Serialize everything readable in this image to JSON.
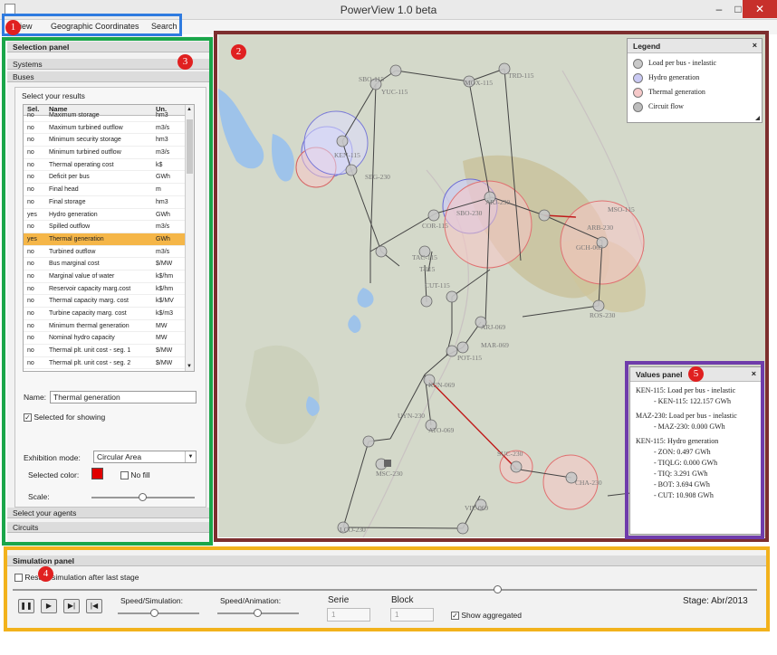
{
  "window": {
    "title": "PowerView 1.0 beta",
    "minimize": "–",
    "maximize": "□",
    "close": "✕"
  },
  "menu": {
    "view": "iew",
    "geo": "Geographic Coordinates",
    "search": "Search"
  },
  "callouts": [
    "1",
    "2",
    "3",
    "4",
    "5"
  ],
  "selection": {
    "title": "Selection panel",
    "systems": "Systems",
    "buses": "Buses",
    "select_results": "Select your results",
    "columns": [
      "Sel.",
      "Name",
      "Un."
    ],
    "rows": [
      [
        "no",
        "Maximum storage",
        "hm3"
      ],
      [
        "no",
        "Maximum turbined outflow",
        "m3/s"
      ],
      [
        "no",
        "Minimum security storage",
        "hm3"
      ],
      [
        "no",
        "Minimum turbined outflow",
        "m3/s"
      ],
      [
        "no",
        "Thermal operating cost",
        "k$"
      ],
      [
        "no",
        "Deficit per bus",
        "GWh"
      ],
      [
        "no",
        "Final head",
        "m"
      ],
      [
        "no",
        "Final storage",
        "hm3"
      ],
      [
        "yes",
        "Hydro generation",
        "GWh"
      ],
      [
        "no",
        "Spilled outflow",
        "m3/s"
      ],
      [
        "yes",
        "Thermal generation",
        "GWh"
      ],
      [
        "no",
        "Turbined outflow",
        "m3/s"
      ],
      [
        "no",
        "Bus marginal cost",
        "$/MW"
      ],
      [
        "no",
        "Marginal value of water",
        "k$/hm"
      ],
      [
        "no",
        "Reservoir capacity marg.cost",
        "k$/hm"
      ],
      [
        "no",
        "Thermal capacity marg. cost",
        "k$/MV"
      ],
      [
        "no",
        "Turbine capacity marg. cost",
        "k$/m3"
      ],
      [
        "no",
        "Minimum thermal generation",
        "MW"
      ],
      [
        "no",
        "Nominal hydro capacity",
        "MW"
      ],
      [
        "no",
        "Thermal plt. unit cost - seg. 1",
        "$/MW"
      ],
      [
        "no",
        "Thermal plt. unit cost - seg. 2",
        "$/MW"
      ]
    ],
    "selected_row": 10,
    "name_label": "Name:",
    "name_value": "Thermal generation",
    "show_label": "Selected for showing",
    "mode_label": "Exhibition mode:",
    "mode_value": "Circular Area",
    "color_label": "Selected color:",
    "color": "#e00000",
    "nofill_label": "No fill",
    "scale_label": "Scale:",
    "agents": "Select your agents",
    "circuits": "Circuits"
  },
  "legend": {
    "title": "Legend",
    "items": [
      {
        "label": "Load per bus - inelastic",
        "color": "#c9c9c9"
      },
      {
        "label": "Hydro generation",
        "color": "#c9c9f3"
      },
      {
        "label": "Thermal generation",
        "color": "#f6c9c9"
      },
      {
        "label": "Circuit flow",
        "color": "#bdbdbd"
      }
    ]
  },
  "values": {
    "title": "Values panel",
    "lines": [
      "KEN-115: Load per bus - inelastic",
      "- KEN-115: 122.157 GWh",
      "",
      "MAZ-230: Load per bus - inelastic",
      "- MAZ-230: 0.000 GWh",
      "",
      "KEN-115: Hydro generation",
      "- ZON: 0.497 GWh",
      "- TIQLG: 0.000 GWh",
      "- TIQ: 3.291 GWh",
      "- BOT: 3.694 GWh",
      "- CUT: 10.908 GWh"
    ]
  },
  "map": {
    "labels": [
      "SBO-115",
      "TRD-115",
      "YUC-115",
      "MOX-115",
      "KEN-115",
      "SEG-230",
      "MSO-115",
      "SBO-230",
      "ARJ-230",
      "ARB-230",
      "COR-115",
      "GCH-069",
      "TAC-115",
      "T-115",
      "ROS-230",
      "CUT-115",
      "ARJ-069",
      "MAR-069",
      "POT-115",
      "KEN-069",
      "UYN-230",
      "ATO-069",
      "MSC-230",
      "VIL-069",
      "LCO-230",
      "SUC-230",
      "CHA-230"
    ]
  },
  "simulation": {
    "title": "Simulation panel",
    "restart": "Restart simulation after last stage",
    "speed_sim": "Speed/Simulation:",
    "speed_anim": "Speed/Animation:",
    "serie_label": "Serie",
    "serie_value": "1",
    "block_label": "Block",
    "block_value": "1",
    "aggregated": "Show aggregated",
    "stage": "Stage: Abr/2013"
  }
}
